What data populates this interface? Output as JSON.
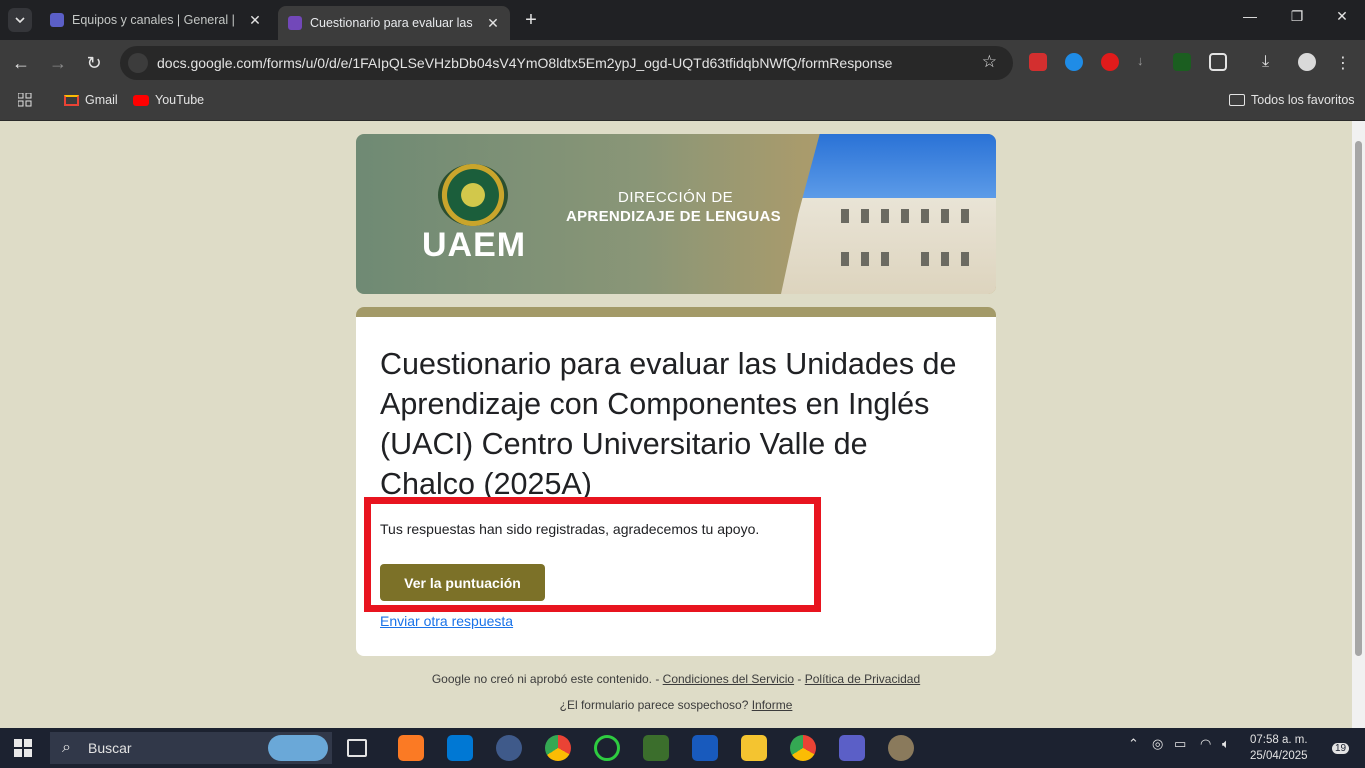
{
  "browser": {
    "tabs": [
      {
        "title": "Equipos y canales | General | M",
        "active": false
      },
      {
        "title": "Cuestionario para evaluar las Un",
        "active": true
      }
    ],
    "url": "docs.google.com/forms/u/0/d/e/1FAIpQLSeVHzbDb04sV4YmO8ldtx5Em2ypJ_ogd-UQTd63tfidqbNWfQ/formResponse",
    "bookmarks": [
      {
        "label": "Gmail"
      },
      {
        "label": "YouTube"
      }
    ],
    "all_bookmarks_label": "Todos los favoritos"
  },
  "banner": {
    "brand": "UAEM",
    "line1": "DIRECCIÓN DE",
    "line2": "APRENDIZAJE DE LENGUAS"
  },
  "form": {
    "title": "Cuestionario para evaluar las Unidades de Aprendizaje con Componentes en Inglés (UACI) Centro Universitario Valle de Chalco (2025A)",
    "confirmation": "Tus respuestas han sido registradas, agradecemos tu apoyo.",
    "score_button": "Ver la puntuación",
    "another_response": "Enviar otra respuesta"
  },
  "footer": {
    "disclaimer": "Google no creó ni aprobó este contenido. - ",
    "terms": "Condiciones del Servicio",
    "sep": " - ",
    "privacy": "Política de Privacidad",
    "suspicious": "¿El formulario parece sospechoso? ",
    "report": "Informe"
  },
  "taskbar": {
    "search_label": "Buscar",
    "time": "07:58 a. m.",
    "date": "25/04/2025",
    "notifications": "19"
  },
  "colors": {
    "accent": "#7c7128",
    "highlight_border": "#e8141f",
    "page_bg": "#dedcc7"
  }
}
